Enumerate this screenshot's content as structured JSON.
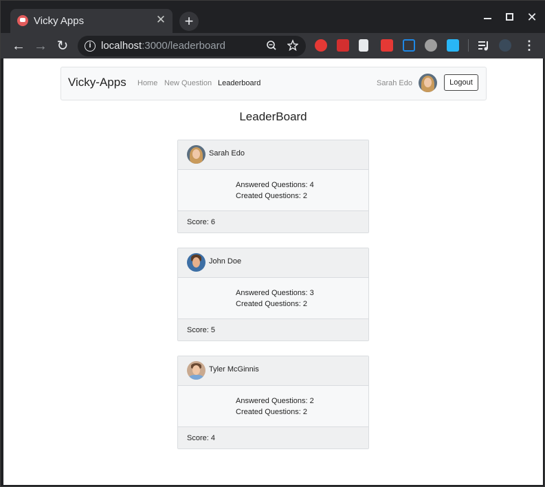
{
  "browser": {
    "tab_title": "Vicky Apps",
    "tab_close": "✕",
    "new_tab": "+",
    "url_host": "localhost",
    "url_path": ":3000/leaderboard"
  },
  "app": {
    "brand": "Vicky-Apps",
    "nav": {
      "home": "Home",
      "new_question": "New Question",
      "leaderboard": "Leaderboard"
    },
    "current_user": "Sarah Edo",
    "logout": "Logout"
  },
  "leaderboard": {
    "title": "LeaderBoard",
    "entries": [
      {
        "name": "Sarah Edo",
        "answered": "Answered Questions: 4",
        "created": "Created Questions: 2",
        "score": "Score: 6"
      },
      {
        "name": "John Doe",
        "answered": "Answered Questions: 3",
        "created": "Created Questions: 2",
        "score": "Score: 5"
      },
      {
        "name": "Tyler McGinnis",
        "answered": "Answered Questions: 2",
        "created": "Created Questions: 2",
        "score": "Score: 4"
      }
    ]
  }
}
